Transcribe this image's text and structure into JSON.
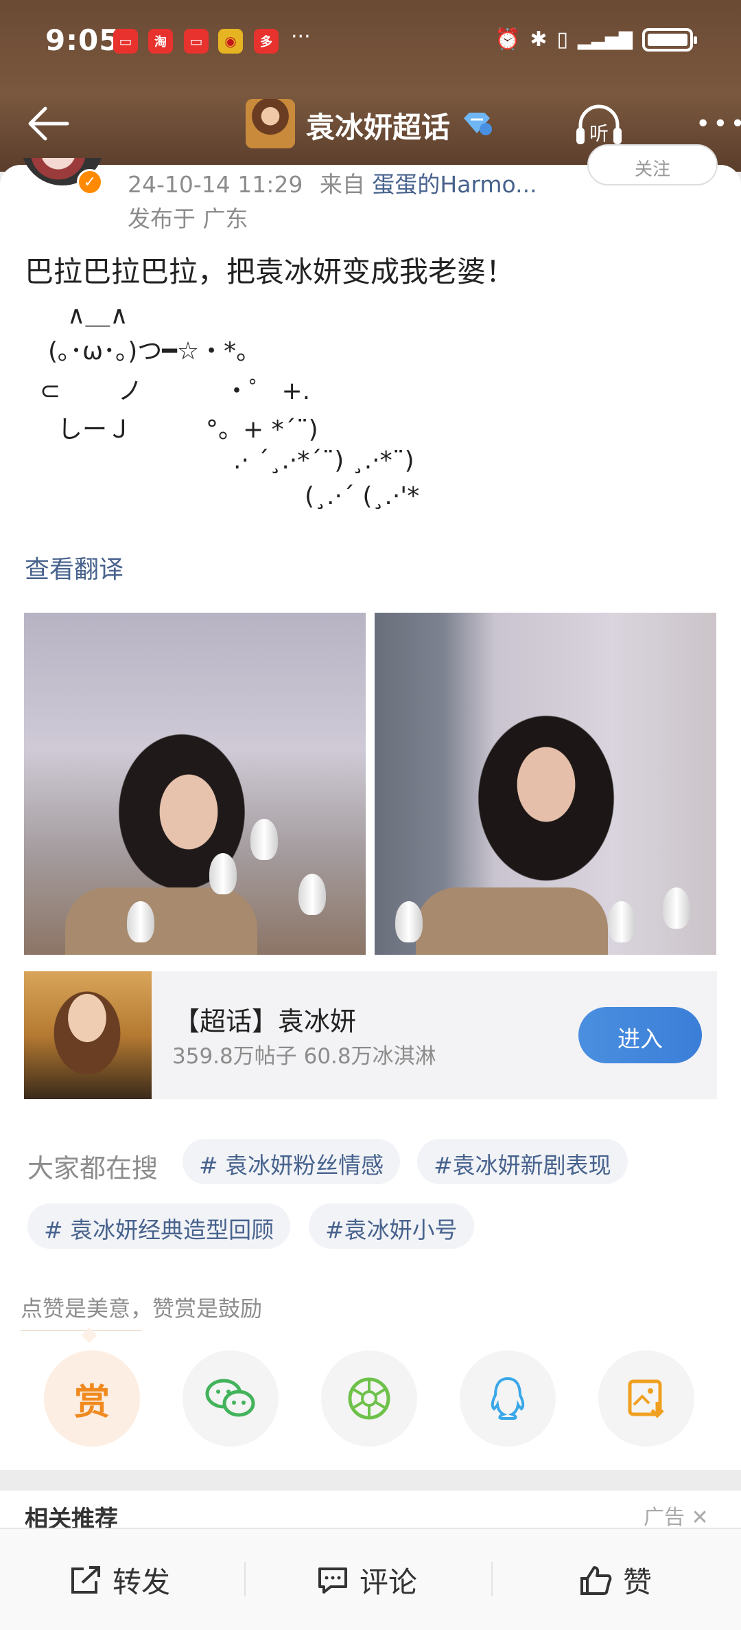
{
  "status_bar": {
    "time": "9:05",
    "more": "···",
    "apps": [
      {
        "icon": "red-book-icon",
        "glyph": "▭",
        "color": "#e8322e"
      },
      {
        "icon": "taobao-icon",
        "glyph": "淘",
        "color": "#e8322e"
      },
      {
        "icon": "red-book-icon",
        "glyph": "▭",
        "color": "#e8322e"
      },
      {
        "icon": "weibo-icon",
        "glyph": "◉",
        "color": "#e6b422"
      },
      {
        "icon": "pinduoduo-icon",
        "glyph": "多",
        "color": "#e8322e"
      }
    ]
  },
  "nav": {
    "title": "袁冰妍超话",
    "listen_label": "听"
  },
  "post": {
    "timestamp": "24-10-14 11:29",
    "from_label": "来自",
    "source": "蛋蛋的Harmo...",
    "location": "发布于 广东",
    "follow_label": "关注",
    "text": "巴拉巴拉巴拉，把袁冰妍变成我老婆！",
    "kaomoji": [
      "∧＿∧",
      "(｡･ω･｡)つ━☆・*。",
      "⊂　　 ノ 　　　・゜ +.",
      "しーＪ　　　°。+ *´¨)",
      ".· ´¸.·*´¨) ¸.·*¨)",
      "(¸.·´ (¸.·'*"
    ],
    "translate_label": "查看翻译"
  },
  "topic": {
    "title": "【超话】袁冰妍",
    "stats": "359.8万帖子 60.8万冰淇淋",
    "enter_label": "进入"
  },
  "search": {
    "label": "大家都在搜",
    "tags": [
      "# 袁冰妍粉丝情感",
      "#袁冰妍新剧表现",
      "# 袁冰妍经典造型回顾",
      "#袁冰妍小号"
    ]
  },
  "share": {
    "praise_text": "点赞是美意，赞赏是鼓励",
    "reward_label": "赏",
    "buttons": [
      "wechat-icon",
      "moments-icon",
      "qq-icon",
      "save-image-icon"
    ]
  },
  "related": {
    "title": "相关推荐",
    "ad_label": "广告"
  },
  "bottom_bar": {
    "repost": "转发",
    "comment": "评论",
    "like": "赞"
  }
}
